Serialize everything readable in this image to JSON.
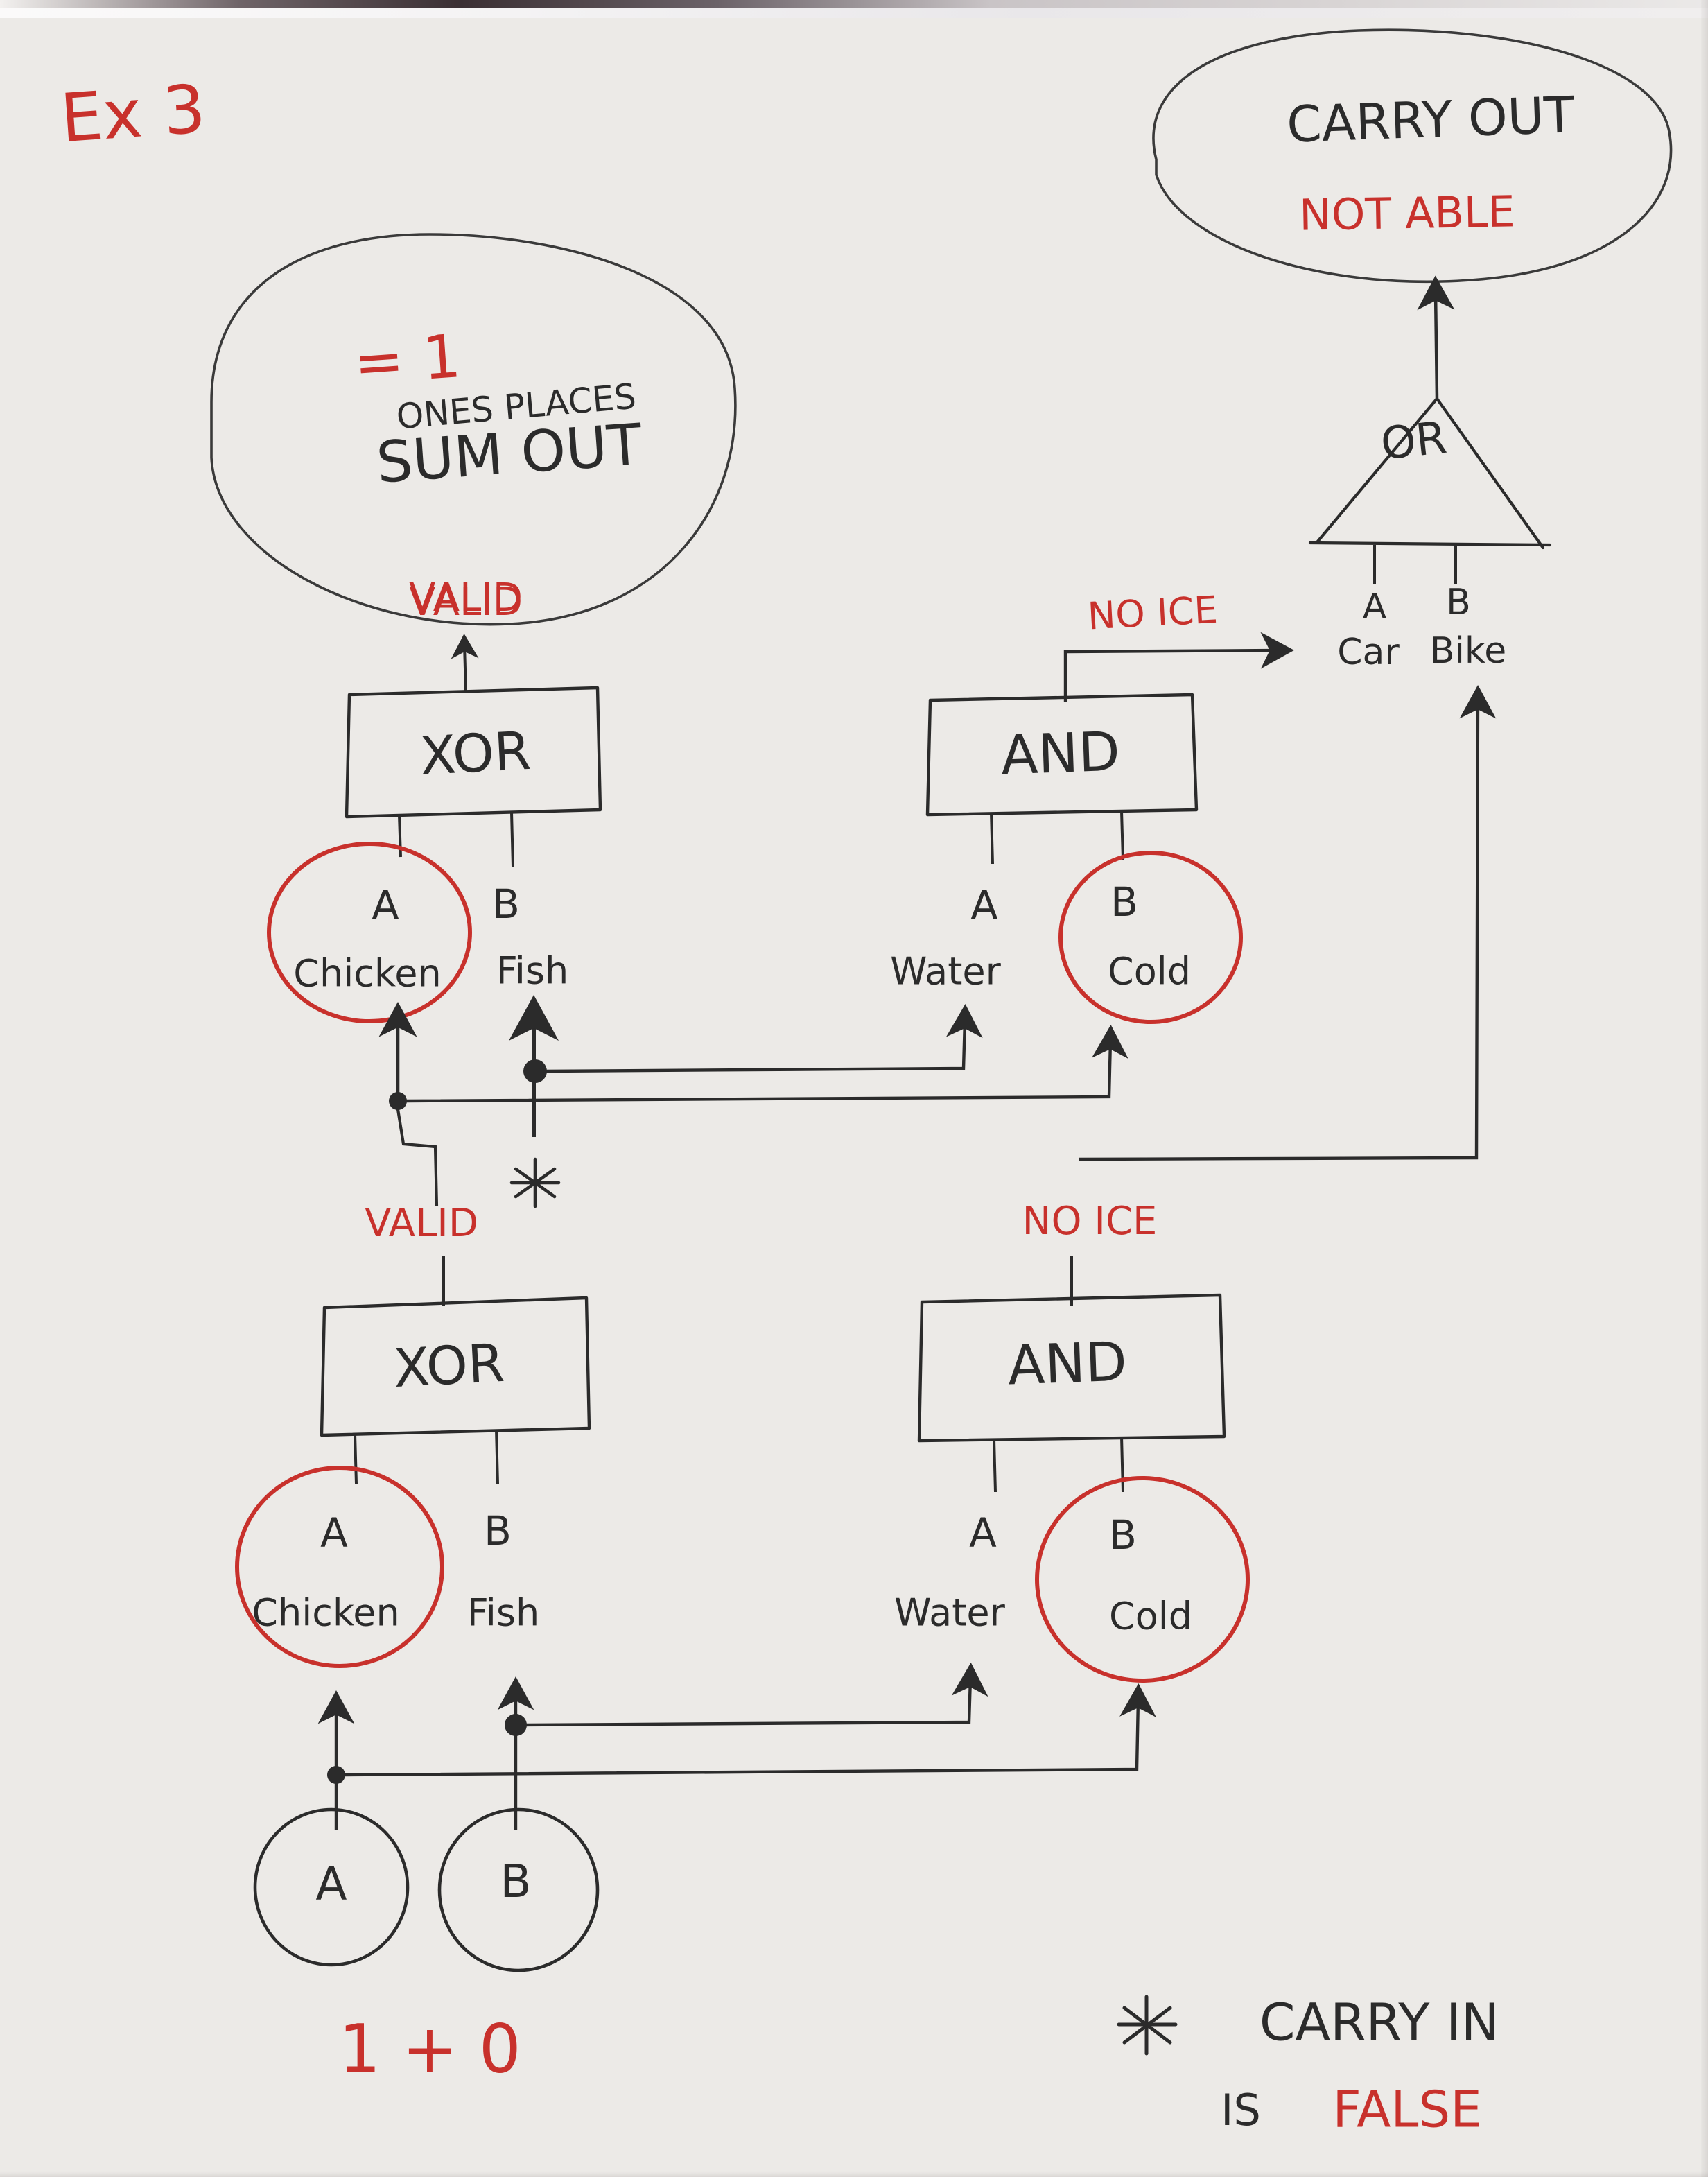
{
  "title": "Ex 3",
  "colors": {
    "ink_black": "#2b2b2b",
    "ink_red": "#c8312c",
    "board": "#eceae7"
  },
  "bubbles": {
    "sum_out": {
      "equals": "= 1",
      "ones_places": "ONES PLACES",
      "name": "SUM OUT",
      "status": "VALID"
    },
    "carry_out": {
      "name": "CARRY OUT",
      "status": "NOT ABLE"
    }
  },
  "or_gate": {
    "label": "OR",
    "input_a_letter": "A",
    "input_b_letter": "B",
    "input_a_word": "Car",
    "input_b_word": "Bike"
  },
  "upper_row": {
    "xor": {
      "label": "XOR",
      "output_label": "VALID",
      "input_a_letter": "A",
      "input_a_word": "Chicken",
      "input_b_letter": "B",
      "input_b_word": "Fish"
    },
    "and": {
      "label": "AND",
      "output_label": "NO ICE",
      "input_a_letter": "A",
      "input_a_word": "Water",
      "input_b_letter": "B",
      "input_b_word": "Cold"
    }
  },
  "lower_row": {
    "xor": {
      "label": "XOR",
      "output_label": "VALID",
      "input_a_letter": "A",
      "input_a_word": "Chicken",
      "input_b_letter": "B",
      "input_b_word": "Fish"
    },
    "and": {
      "label": "AND",
      "output_label": "NO ICE",
      "input_a_letter": "A",
      "input_a_word": "Water",
      "input_b_letter": "B",
      "input_b_word": "Cold"
    }
  },
  "inputs": {
    "a_label": "A",
    "b_label": "B"
  },
  "footer": {
    "sum_expression": "1 + 0",
    "asterisk": "✳",
    "note_line1": "CARRY IN",
    "note_line2_black": "IS",
    "note_line2_red": "FALSE"
  },
  "annotations": {
    "carry_in_marker": "✳"
  }
}
